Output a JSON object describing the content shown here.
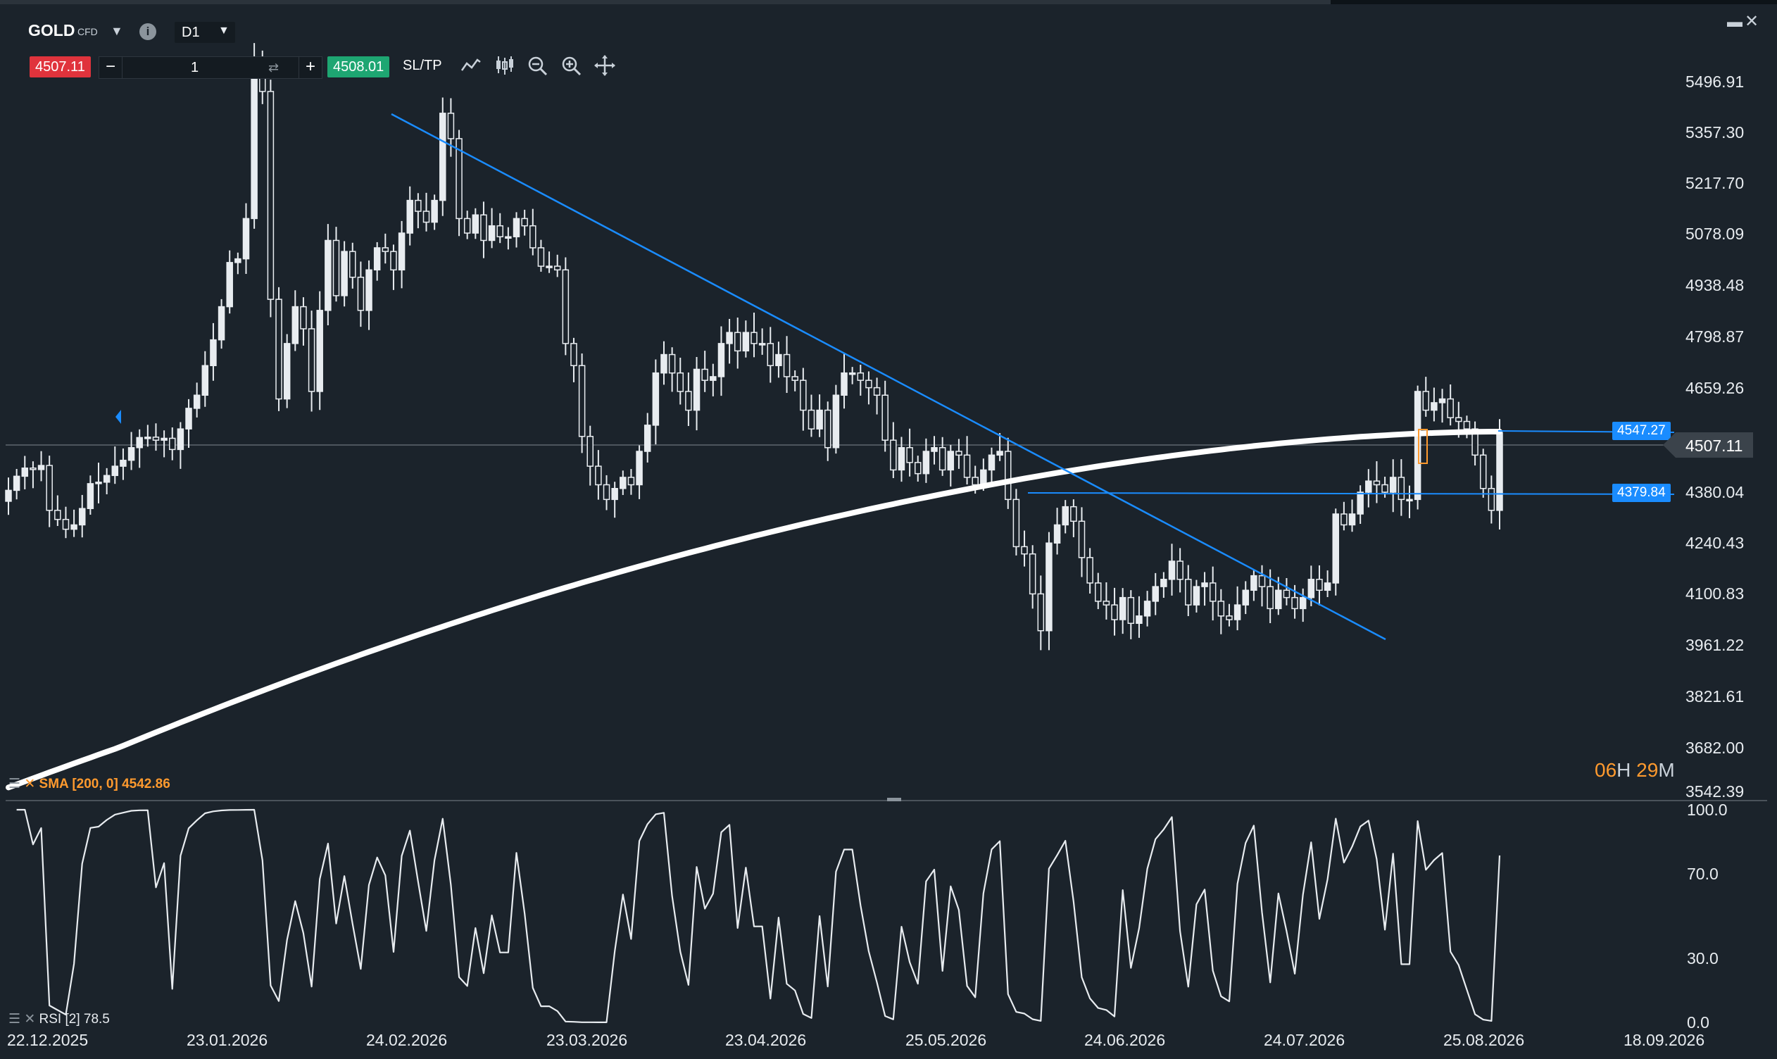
{
  "header": {
    "symbol": "GOLD",
    "symbol_type": "CFD",
    "timeframe": "D1",
    "sell_price": "4507.11",
    "buy_price": "4508.01",
    "quantity": "1",
    "sltp_label": "SL/TP"
  },
  "icons": [
    "caret-down-icon",
    "info-icon",
    "line-chart-icon",
    "candlestick-icon",
    "zoom-out-icon",
    "zoom-in-icon",
    "crosshair-icon",
    "minimize-icon",
    "close-icon",
    "settings-icon"
  ],
  "colors": {
    "background": "#1b232b",
    "sell": "#e0333c",
    "buy": "#1ea672",
    "trendline": "#1a8cff",
    "sma": "#ffffff",
    "indicator_label": "#ff9a2e"
  },
  "price_labels": {
    "current": "4507.11",
    "level_upper": "4547.27",
    "level_lower": "4379.84"
  },
  "countdown": {
    "hours": "06",
    "h_unit": "H",
    "minutes": "29",
    "m_unit": "M"
  },
  "indicators": {
    "sma_label": "SMA [200, 0] 4542.86",
    "rsi_label": "RSI [2] 78.5"
  },
  "chart_data": [
    {
      "type": "candlestick",
      "title": "GOLD CFD D1",
      "y_ticks": [
        "5496.91",
        "5357.30",
        "5217.70",
        "5078.09",
        "4938.48",
        "4798.87",
        "4659.26",
        "4507.11",
        "4380.04",
        "4240.43",
        "4100.83",
        "3961.22",
        "3821.61",
        "3682.00",
        "3542.39"
      ],
      "ylim": [
        3542.39,
        5566.0
      ],
      "x_ticks": [
        "22.12.2025",
        "23.01.2026",
        "24.02.2026",
        "23.03.2026",
        "23.04.2026",
        "25.05.2026",
        "24.06.2026",
        "24.07.2026",
        "25.08.2026",
        "18.09.2026"
      ],
      "close": [
        4385,
        4423,
        4445,
        4441,
        4452,
        4330,
        4305,
        4278,
        4290,
        4335,
        4403,
        4407,
        4425,
        4450,
        4466,
        4500,
        4527,
        4528,
        4520,
        4525,
        4495,
        4550,
        4605,
        4640,
        4720,
        4790,
        4880,
        5000,
        5010,
        5120,
        5550,
        5470,
        4900,
        4630,
        4780,
        4880,
        4820,
        4650,
        4870,
        5060,
        4910,
        5030,
        4960,
        4870,
        4980,
        5040,
        5030,
        4980,
        5080,
        5170,
        5140,
        5110,
        5170,
        5410,
        5340,
        5120,
        5080,
        5130,
        5060,
        5100,
        5070,
        5070,
        5120,
        5100,
        5040,
        4990,
        4990,
        4980,
        4780,
        4720,
        4530,
        4450,
        4400,
        4360,
        4390,
        4420,
        4400,
        4490,
        4560,
        4700,
        4750,
        4700,
        4650,
        4600,
        4710,
        4680,
        4690,
        4780,
        4810,
        4760,
        4810,
        4780,
        4780,
        4720,
        4750,
        4690,
        4680,
        4600,
        4550,
        4600,
        4500,
        4640,
        4700,
        4700,
        4680,
        4660,
        4640,
        4520,
        4440,
        4500,
        4460,
        4430,
        4490,
        4500,
        4440,
        4490,
        4480,
        4420,
        4400,
        4440,
        4480,
        4490,
        4360,
        4230,
        4210,
        4100,
        4000,
        4240,
        4290,
        4340,
        4300,
        4200,
        4130,
        4080,
        4070,
        4030,
        4090,
        4020,
        4040,
        4080,
        4120,
        4140,
        4190,
        4140,
        4070,
        4120,
        4130,
        4080,
        4040,
        4030,
        4070,
        4110,
        4150,
        4120,
        4060,
        4110,
        4090,
        4060,
        4090,
        4140,
        4110,
        4130,
        4320,
        4290,
        4320,
        4380,
        4410,
        4400,
        4380,
        4420,
        4360,
        4360,
        4650,
        4600,
        4620,
        4630,
        4580,
        4570,
        4550,
        4480,
        4390,
        4330,
        4540
      ]
    },
    {
      "type": "line",
      "title": "SMA [200, 0]",
      "last_value": 4542.86
    },
    {
      "type": "line",
      "title": "RSI [2]",
      "y_ticks": [
        "100.0",
        "70.0",
        "30.0",
        "0.0"
      ],
      "ylim": [
        0,
        100
      ],
      "last_value": 78.5
    }
  ]
}
